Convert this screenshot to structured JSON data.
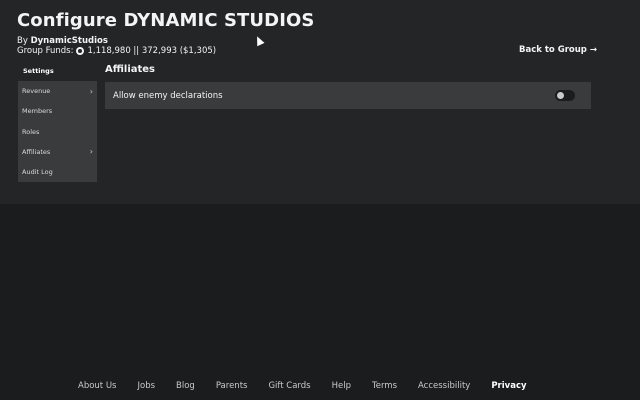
{
  "header": {
    "title": "Configure DYNAMIC STUDIOS",
    "by_label": "By",
    "owner": "DynamicStudios",
    "funds_label": "Group Funds:",
    "funds_value": "1,118,980 || 372,993 ($1,305)",
    "back_link": "Back to Group →"
  },
  "sidebar": {
    "items": [
      {
        "label": "Settings",
        "active": true,
        "chevron": ""
      },
      {
        "label": "Revenue",
        "active": false,
        "chevron": "›"
      },
      {
        "label": "Members",
        "active": false,
        "chevron": ""
      },
      {
        "label": "Roles",
        "active": false,
        "chevron": ""
      },
      {
        "label": "Affiliates",
        "active": false,
        "chevron": "›"
      },
      {
        "label": "Audit Log",
        "active": false,
        "chevron": ""
      }
    ]
  },
  "main": {
    "section_title": "Affiliates",
    "setting_label": "Allow enemy declarations",
    "toggle_on": false
  },
  "footer": {
    "links": [
      "About Us",
      "Jobs",
      "Blog",
      "Parents",
      "Gift Cards",
      "Help",
      "Terms",
      "Accessibility",
      "Privacy"
    ]
  },
  "colors": {
    "page_bg": "#1b1c1e",
    "panel_bg": "#232527",
    "card_bg": "#393b3d",
    "text": "#f2f4f5"
  }
}
